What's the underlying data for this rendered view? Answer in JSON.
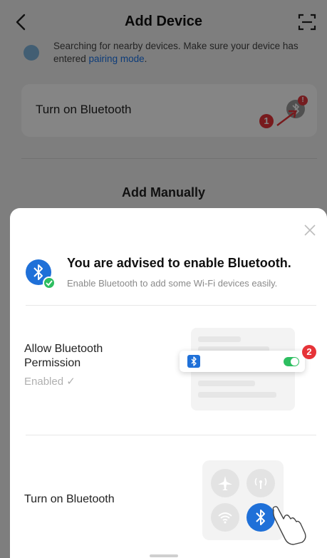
{
  "header": {
    "title": "Add Device",
    "back_icon": "chevron-left-icon",
    "scan_icon": "scan-icon"
  },
  "search": {
    "text": "Searching for nearby devices. Make sure your device has entered ",
    "link": "pairing mode",
    "suffix": "."
  },
  "bluetooth_card": {
    "label": "Turn on Bluetooth",
    "alert": "!"
  },
  "add_manually": "Add Manually",
  "markers": [
    "1",
    "2"
  ],
  "sheet": {
    "title": "You are advised to enable Bluetooth.",
    "subtitle": "Enable Bluetooth to add some Wi-Fi devices easily.",
    "permission": {
      "title": "Allow Bluetooth Permission",
      "status": "Enabled ✓"
    },
    "turn_on": {
      "title": "Turn on Bluetooth"
    }
  },
  "colors": {
    "accent": "#1f70d8",
    "toggle_on": "#2dbe60",
    "marker": "#e63338",
    "link": "#1a73e8"
  }
}
